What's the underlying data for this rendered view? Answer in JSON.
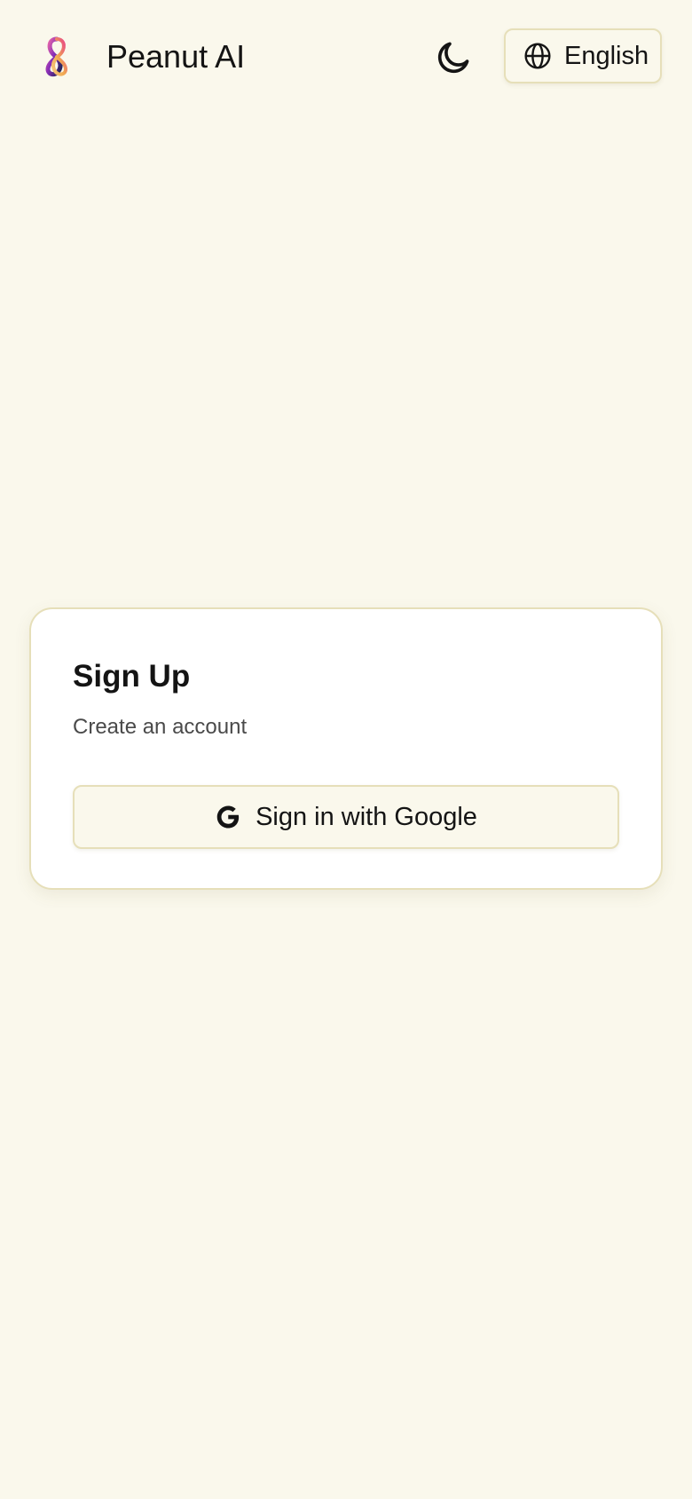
{
  "header": {
    "logo_icon": "peanut-ai-logo-icon",
    "title": "Peanut AI",
    "theme_toggle_icon": "moon-icon",
    "language_icon": "globe-icon",
    "language_label": "English"
  },
  "card": {
    "title": "Sign Up",
    "subtitle": "Create an account",
    "google_icon": "google-g-icon",
    "google_button_label": "Sign in with Google"
  },
  "colors": {
    "background": "#faf8ec",
    "card_background": "#ffffff",
    "border": "#e6dfb9",
    "text": "#141414",
    "muted_text": "#4a4a4a",
    "logo_pink": "#e83e8c",
    "logo_purple": "#6b2fa8",
    "logo_navy": "#1c2452",
    "logo_orange": "#f0a850"
  }
}
